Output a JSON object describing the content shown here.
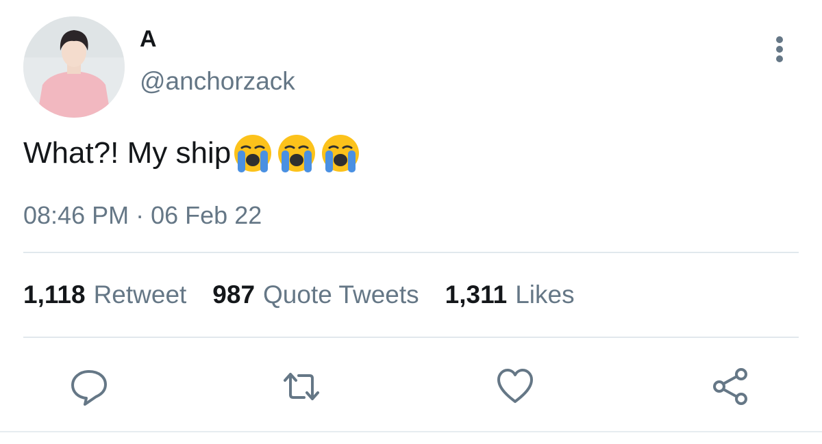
{
  "author": {
    "display_name": "A",
    "handle": "@anchorzack"
  },
  "tweet": {
    "text": "What?! My ship",
    "emojis": [
      "loudly-crying-face",
      "loudly-crying-face",
      "loudly-crying-face"
    ],
    "time": "08:46 PM",
    "separator": "·",
    "date": "06 Feb 22"
  },
  "stats": {
    "retweets": {
      "count": "1,118",
      "label": "Retweet"
    },
    "quotes": {
      "count": "987",
      "label": "Quote Tweets"
    },
    "likes": {
      "count": "1,311",
      "label": "Likes"
    }
  },
  "actions": [
    "reply-icon",
    "retweet-icon",
    "like-icon",
    "share-icon"
  ],
  "colors": {
    "text_primary": "#14171a",
    "text_secondary": "#657786",
    "divider": "#e1e8ed",
    "icon": "#657786"
  }
}
